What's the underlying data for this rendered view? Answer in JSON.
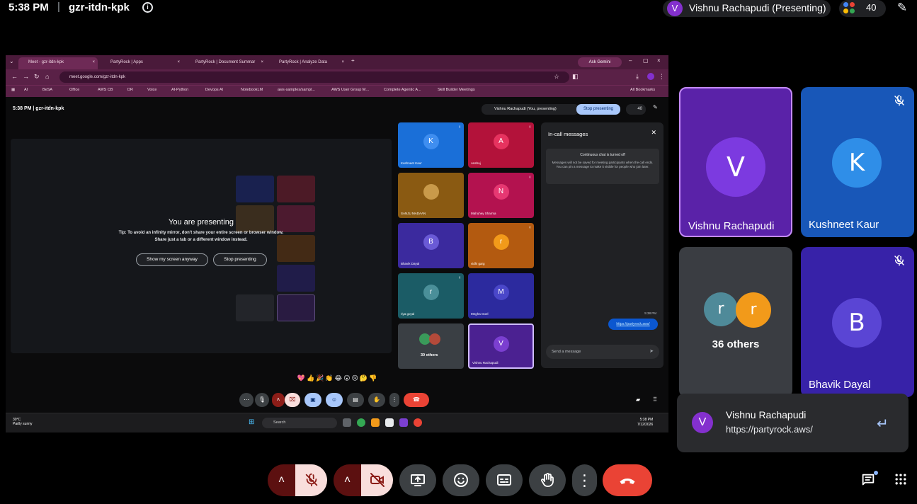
{
  "meeting": {
    "time": "5:38 PM",
    "separator": "|",
    "code": "gzr-itdn-kpk",
    "info_icon": "i",
    "presenter_initial": "V",
    "presenter_label": "Vishnu Rachapudi (Presenting)",
    "participant_count": "40",
    "edit_icon": "✎"
  },
  "shared_screen": {
    "tabs": [
      {
        "label": "Meet - gzr-itdn-kpk"
      },
      {
        "label": "PartyRock | Apps"
      },
      {
        "label": "PartyRock | Document Summar"
      },
      {
        "label": "PartyRock | Analyze Data"
      }
    ],
    "new_tab": "+",
    "ask_gemini": "Ask Gemini",
    "url": "meet.google.com/gzr-itdn-kpk",
    "bookmarks": [
      "AI",
      "BeSA",
      "Office",
      "AWS CB",
      "DR",
      "Voice",
      "AI-Python",
      "Devops AI",
      "NotebookLM",
      "aws-samples/sampl...",
      "AWS User Group M...",
      "Complete Agentic A...",
      "Skill Builder Meetings"
    ],
    "all_bookmarks": "All Bookmarks",
    "inner_time": "5:38 PM  |  gzr-itdn-kpk",
    "inner_presenter": "Vishnu Rachapudi (You, presenting)",
    "inner_stop": "Stop presenting",
    "inner_count": "40",
    "presenting_title": "You are presenting",
    "presenting_msg1": "Tip: To avoid an infinity mirror, don't share your entire screen or browser window.",
    "presenting_msg2": "Share just a tab or a different window instead.",
    "show_anyway": "Show my screen anyway",
    "stop_presenting": "Stop presenting",
    "grid": [
      {
        "initial": "K",
        "name": "Kushneet Kaur",
        "color": "#1a6fd8",
        "avatar": "#3f8ef0"
      },
      {
        "initial": "A",
        "name": "Anshuj",
        "color": "#b3123a",
        "avatar": "#e6335f"
      },
      {
        "initial": "",
        "name": "SANJU MADAAN",
        "color": "#8a5a12",
        "avatar": "#c99a4a"
      },
      {
        "initial": "N",
        "name": "Mahuhey Sharma",
        "color": "#b3124f",
        "avatar": "#e63872"
      },
      {
        "initial": "B",
        "name": "Bhavik Dayal",
        "color": "#3b2a9e",
        "avatar": "#6a5ad6"
      },
      {
        "initial": "r",
        "name": "vidhi garg",
        "color": "#b35a10",
        "avatar": "#f29a1a"
      },
      {
        "initial": "r",
        "name": "riya goyal",
        "color": "#1b5c66",
        "avatar": "#4a8f99"
      },
      {
        "initial": "M",
        "name": "Megha Goel",
        "color": "#2c2a9e",
        "avatar": "#4a47c9"
      },
      {
        "initial": "",
        "name": "30 others",
        "color": "#3a3f44",
        "avatar": "#5f6368"
      },
      {
        "initial": "V",
        "name": "Vishnu Rachapudi",
        "color": "#4b2191",
        "avatar": "#7b3fd0"
      }
    ],
    "chat": {
      "title": "In-call messages",
      "notice_title": "Continuous chat is turned off",
      "notice_body": "Messages will not be saved for meeting participants when the call ends. You can pin a message to make it visible for people who join later.",
      "time": "5:38 PM",
      "link": "https://partyrock.aws/",
      "input_placeholder": "Send a message"
    },
    "reactions": "💖👍🎉👏😂😮😢🤔👎",
    "taskbar": {
      "weather_temp": "30°C",
      "weather_desc": "Partly sunny",
      "search": "Search",
      "clock_time": "5:38 PM",
      "clock_date": "7/12/2026"
    }
  },
  "participants": [
    {
      "initial": "V",
      "name": "Vishnu Rachapudi",
      "tile_color": "#5a22a8",
      "avatar_color": "#7c3ae0",
      "muted": false,
      "active": true
    },
    {
      "initial": "K",
      "name": "Kushneet Kaur",
      "tile_color": "#1857b8",
      "avatar_color": "#2f8ee8",
      "muted": true,
      "active": false
    },
    {
      "initial": "r",
      "name": "36 others",
      "tile_color": "#3a3d42",
      "avatar_color": "#4f8a99",
      "muted": false,
      "active": false
    },
    {
      "initial": "B",
      "name": "Bhavik Dayal",
      "tile_color": "#3722a8",
      "avatar_color": "#5a45d4",
      "muted": true,
      "active": false
    }
  ],
  "others_second_initial": "r",
  "toast": {
    "initial": "V",
    "sender": "Vishnu Rachapudi",
    "message": "https://partyrock.aws/",
    "reply_icon": "↵"
  },
  "controls": {
    "mic_chevron": "˄",
    "cam_chevron": "˄",
    "more": "⋮"
  },
  "colors": {
    "accent_purple": "#8430ce",
    "leave_red": "#ea4335",
    "muted_tile": "#f9dedc",
    "chrome_tab_bar": "#4a1a3a"
  }
}
